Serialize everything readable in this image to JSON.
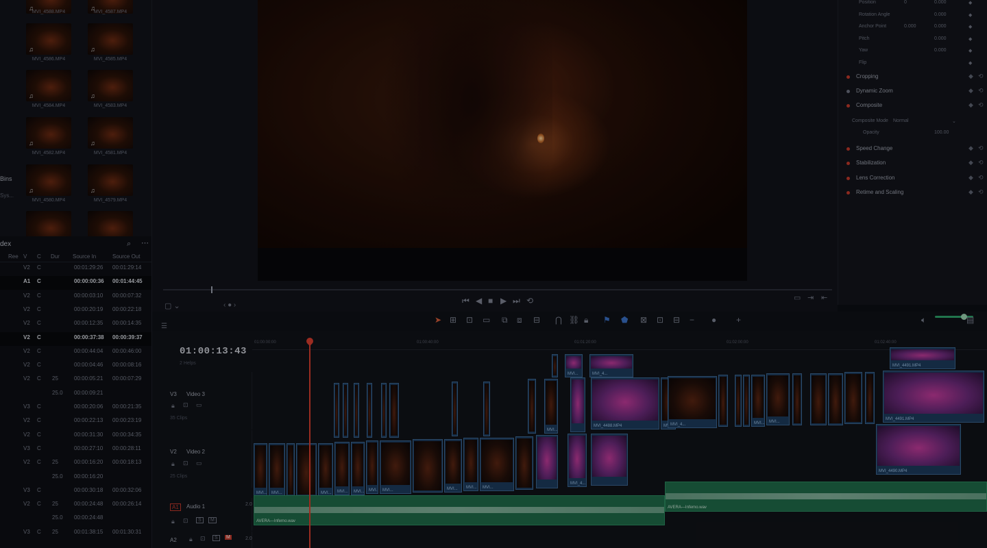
{
  "media_pool": {
    "thumbnails": [
      {
        "label": "MVI_4588.MP4"
      },
      {
        "label": "MVI_4587.MP4"
      },
      {
        "label": "MVI_4586.MP4"
      },
      {
        "label": "MVI_4585.MP4"
      },
      {
        "label": "MVI_4584.MP4"
      },
      {
        "label": "MVI_4583.MP4"
      },
      {
        "label": "MVI_4582.MP4"
      },
      {
        "label": "MVI_4581.MP4"
      },
      {
        "label": "MVI_4580.MP4"
      },
      {
        "label": "MVI_4579.MP4"
      },
      {
        "label": ""
      },
      {
        "label": ""
      }
    ],
    "bins_label": "Bins",
    "bins_sub": "Sys..."
  },
  "index": {
    "title": "dex",
    "columns": [
      "Ree",
      "V",
      "C",
      "Dur",
      "Source In",
      "Source Out"
    ],
    "rows": [
      {
        "v": "V2",
        "c": "C",
        "dur": "",
        "in": "00:01:29:26",
        "out": "00:01:29:14",
        "hl": false
      },
      {
        "v": "A1",
        "c": "C",
        "dur": "",
        "in": "00:00:00:36",
        "out": "00:01:44:45",
        "hl": true
      },
      {
        "v": "V2",
        "c": "C",
        "dur": "",
        "in": "00:00:03:10",
        "out": "00:00:07:32",
        "hl": false
      },
      {
        "v": "V2",
        "c": "C",
        "dur": "",
        "in": "00:00:20:19",
        "out": "00:00:22:18",
        "hl": false
      },
      {
        "v": "V2",
        "c": "C",
        "dur": "",
        "in": "00:00:12:35",
        "out": "00:00:14:35",
        "hl": false
      },
      {
        "v": "V2",
        "c": "C",
        "dur": "",
        "in": "00:00:37:38",
        "out": "00:00:39:37",
        "hl": true
      },
      {
        "v": "V2",
        "c": "C",
        "dur": "",
        "in": "00:00:44:04",
        "out": "00:00:46:00",
        "hl": false
      },
      {
        "v": "V2",
        "c": "C",
        "dur": "",
        "in": "00:00:04:46",
        "out": "00:00:08:16",
        "hl": false
      },
      {
        "v": "V2",
        "c": "C",
        "dur": "25",
        "in": "00:00:05:21",
        "out": "00:00:07:29",
        "hl": false
      },
      {
        "v": "",
        "c": "",
        "dur": "25.0",
        "in": "00:00:09:21",
        "out": "",
        "hl": false
      },
      {
        "v": "V3",
        "c": "C",
        "dur": "",
        "in": "00:00:20:06",
        "out": "00:00:21:35",
        "hl": false
      },
      {
        "v": "V2",
        "c": "C",
        "dur": "",
        "in": "00:00:22:13",
        "out": "00:00:23:19",
        "hl": false
      },
      {
        "v": "V2",
        "c": "C",
        "dur": "",
        "in": "00:00:31:30",
        "out": "00:00:34:35",
        "hl": false
      },
      {
        "v": "V3",
        "c": "C",
        "dur": "",
        "in": "00:00:27:10",
        "out": "00:00:28:11",
        "hl": false
      },
      {
        "v": "V2",
        "c": "C",
        "dur": "25",
        "in": "00:00:16:20",
        "out": "00:00:18:13",
        "hl": false
      },
      {
        "v": "",
        "c": "",
        "dur": "25.0",
        "in": "00:00:16:20",
        "out": "",
        "hl": false
      },
      {
        "v": "V3",
        "c": "C",
        "dur": "",
        "in": "00:00:30:18",
        "out": "00:00:32:06",
        "hl": false
      },
      {
        "v": "V2",
        "c": "C",
        "dur": "25",
        "in": "00:00:24:48",
        "out": "00:00:26:14",
        "hl": false
      },
      {
        "v": "",
        "c": "",
        "dur": "25.0",
        "in": "00:00:24:48",
        "out": "",
        "hl": false
      },
      {
        "v": "V3",
        "c": "C",
        "dur": "25",
        "in": "00:01:38:15",
        "out": "00:01:30:31",
        "hl": false
      }
    ]
  },
  "inspector": {
    "rows": [
      {
        "label": "Position",
        "v1": "0",
        "v2": "0.000"
      },
      {
        "label": "Rotation Angle",
        "v1": "",
        "v2": "0.000"
      },
      {
        "label": "Anchor Point",
        "v1": "0.000",
        "v2": "0.000"
      },
      {
        "label": "Pitch",
        "v1": "",
        "v2": "0.000"
      },
      {
        "label": "Yaw",
        "v1": "",
        "v2": "0.000"
      },
      {
        "label": "Flip",
        "v1": "",
        "v2": ""
      }
    ],
    "sections": [
      {
        "label": "Cropping",
        "active": true
      },
      {
        "label": "Dynamic Zoom",
        "active": false
      },
      {
        "label": "Composite",
        "active": true
      },
      {
        "label": "Speed Change",
        "active": true
      },
      {
        "label": "Stabilization",
        "active": true
      },
      {
        "label": "Lens Correction",
        "active": true
      },
      {
        "label": "Retime and Scaling",
        "active": true
      }
    ],
    "composite_mode_label": "Composite Mode",
    "composite_mode_value": "Normal",
    "opacity_label": "Opacity",
    "opacity_value": "100.00"
  },
  "timeline": {
    "timecode": "01:00:13:43",
    "tc_sub": "2 Helps",
    "ruler": [
      "01:00:00:00",
      "01:00:40:00",
      "01:01:20:00",
      "01:02:00:00",
      "01:02:40:00"
    ],
    "tracks": {
      "v3": {
        "id": "V3",
        "name": "Video 3",
        "sub": "35 Clips"
      },
      "v2": {
        "id": "V2",
        "name": "Video 2",
        "sub": "25 Clips"
      },
      "a1": {
        "id": "A1",
        "name": "Audio 1",
        "level": "2.0"
      },
      "a2": {
        "id": "A2",
        "level": "2.0"
      }
    },
    "v3_labels": {
      "a": "MVI...",
      "b": "MVI_4488.MP4",
      "c": "MVI_4...",
      "d": "MVI_4491.MP4",
      "e": "MVI_4...",
      "f": "MVI...",
      "g": "MVI_4488.MP4"
    },
    "v2_labels": {
      "a": "MVI...",
      "b": "MVI...",
      "c": "MVI_4...",
      "d": "MVI_4490.MP4"
    },
    "audio_labels": {
      "a": "AVERA—Inferno.wav",
      "b": "AVERA—Inferno.wav"
    }
  },
  "colors": {
    "accent_red": "#d73d2f",
    "clip_blue": "#1d3b5c",
    "audio_green": "#1f6a48"
  }
}
